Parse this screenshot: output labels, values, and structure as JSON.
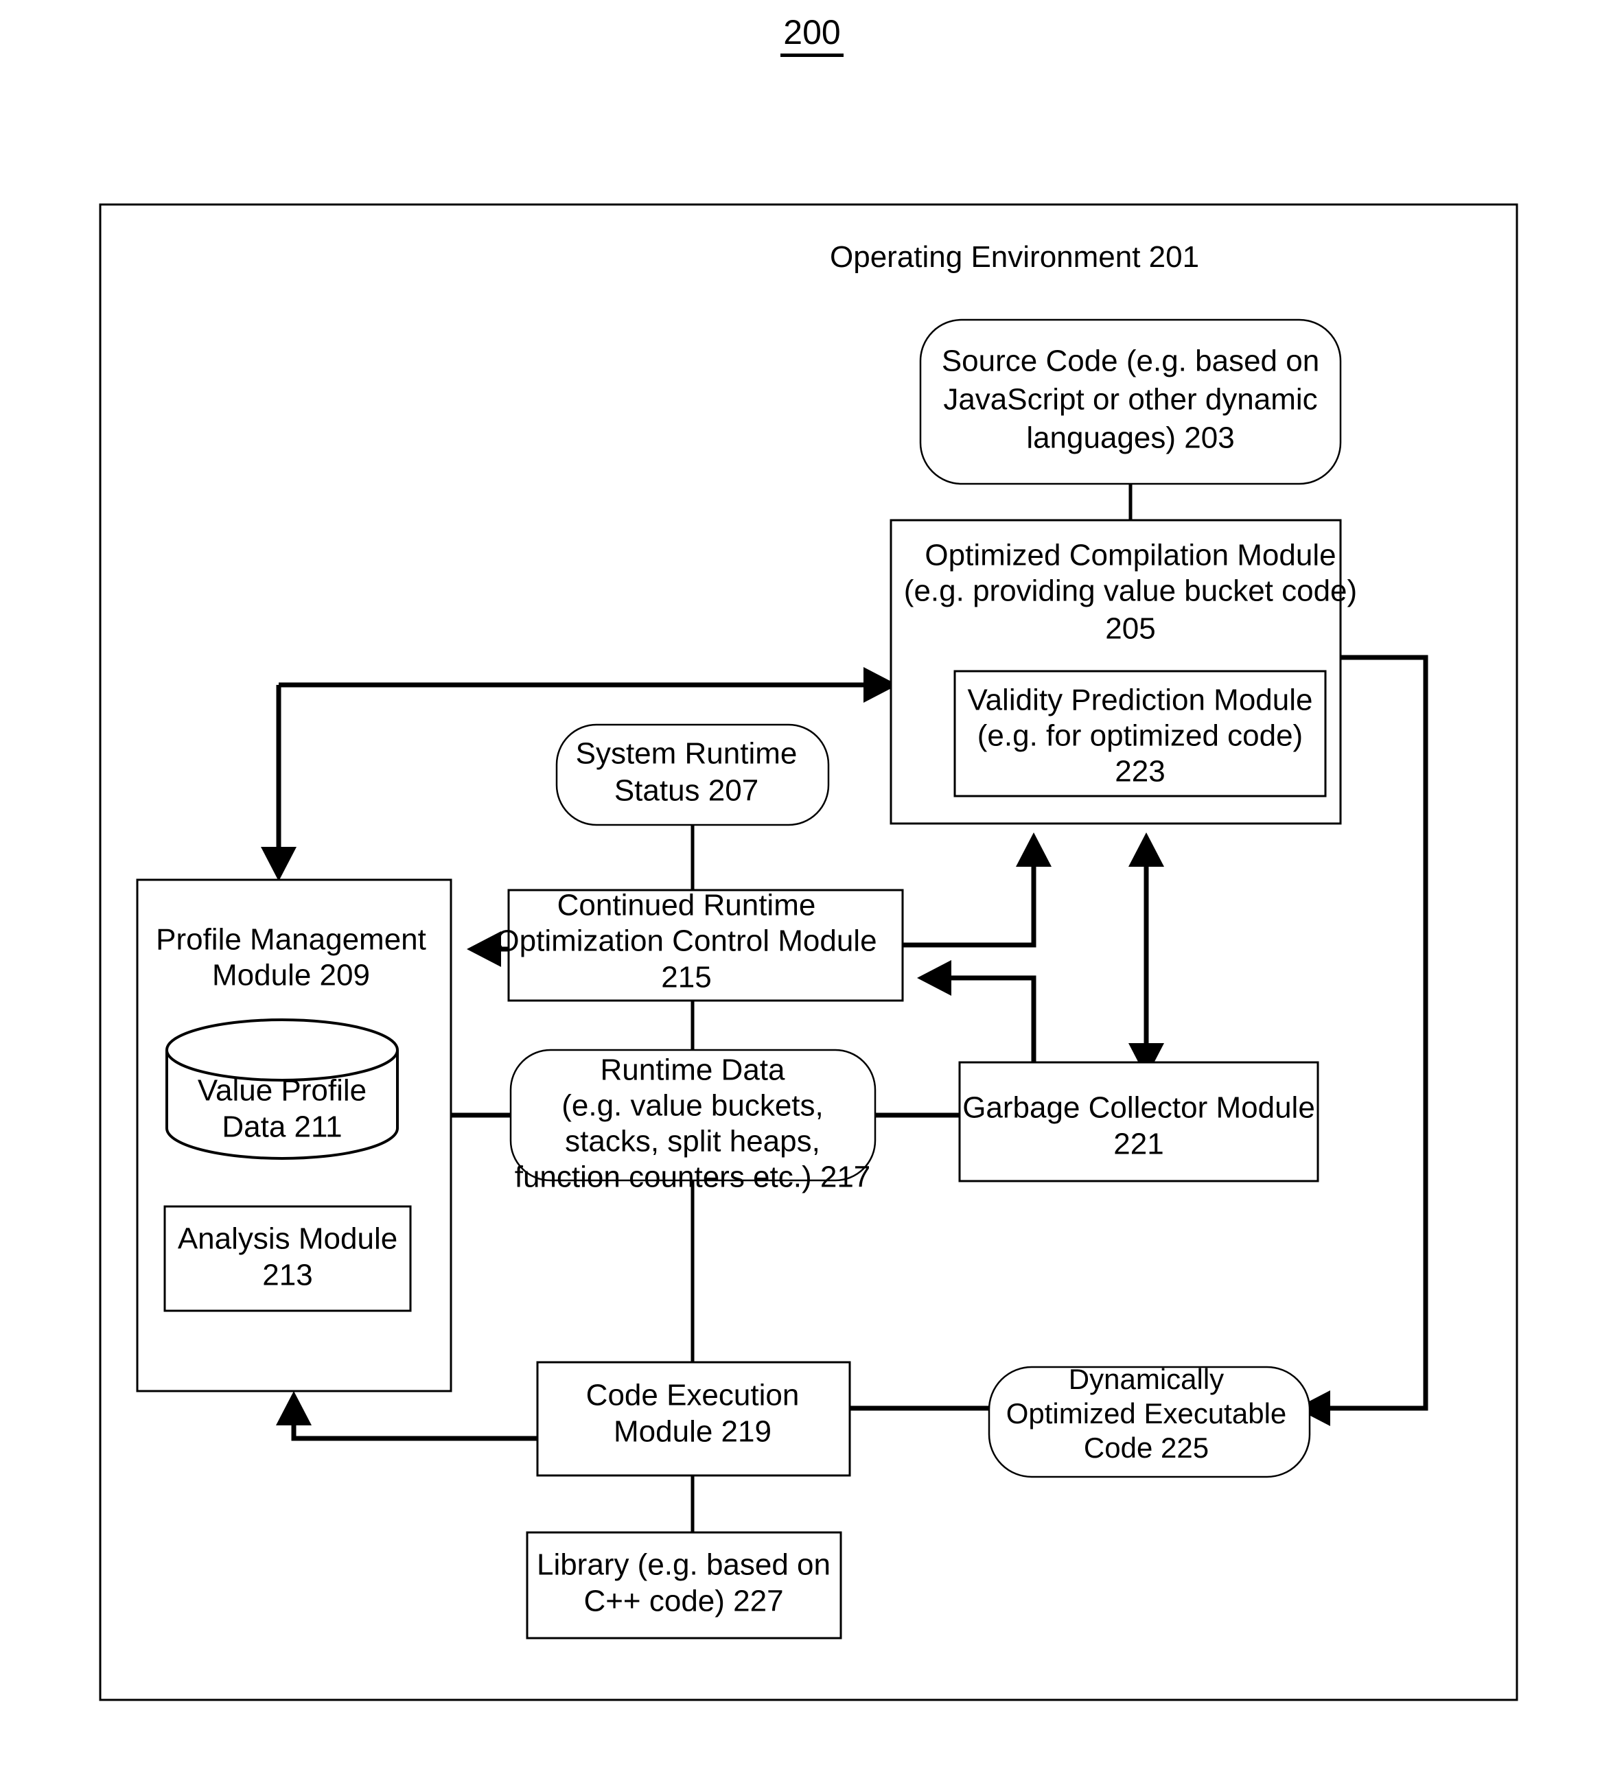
{
  "figure": {
    "number": "200"
  },
  "environment": {
    "label": "Operating Environment 201"
  },
  "nodes": {
    "source_code": {
      "lines": [
        "Source Code (e.g. based on",
        "JavaScript or other dynamic",
        "languages)  203"
      ]
    },
    "optimized_compilation": {
      "lines": [
        "Optimized Compilation Module",
        "(e.g. providing value bucket code)",
        "205"
      ]
    },
    "validity_prediction": {
      "lines": [
        "Validity Prediction Module",
        "(e.g. for optimized code)",
        "223"
      ]
    },
    "system_runtime_status": {
      "lines": [
        "System Runtime",
        "Status 207"
      ]
    },
    "profile_management": {
      "lines": [
        "Profile Management",
        "Module 209"
      ]
    },
    "value_profile_data": {
      "lines": [
        "Value Profile",
        "Data 211"
      ]
    },
    "analysis_module": {
      "lines": [
        "Analysis Module",
        "213"
      ]
    },
    "continued_runtime_optimization": {
      "lines": [
        "Continued Runtime",
        "Optimization Control Module",
        "215"
      ]
    },
    "runtime_data": {
      "lines": [
        "Runtime Data",
        "(e.g. value buckets,",
        "stacks, split heaps,",
        "function counters etc.) 217"
      ]
    },
    "garbage_collector": {
      "lines": [
        "Garbage Collector Module",
        "221"
      ]
    },
    "code_execution": {
      "lines": [
        "Code Execution",
        "Module  219"
      ]
    },
    "dynamically_optimized_code": {
      "lines": [
        "Dynamically",
        "Optimized Executable",
        "Code 225"
      ]
    },
    "library": {
      "lines": [
        "Library (e.g. based on",
        "C++ code) 227"
      ]
    }
  },
  "colors": {
    "stroke": "#000000",
    "fill": "#ffffff"
  }
}
